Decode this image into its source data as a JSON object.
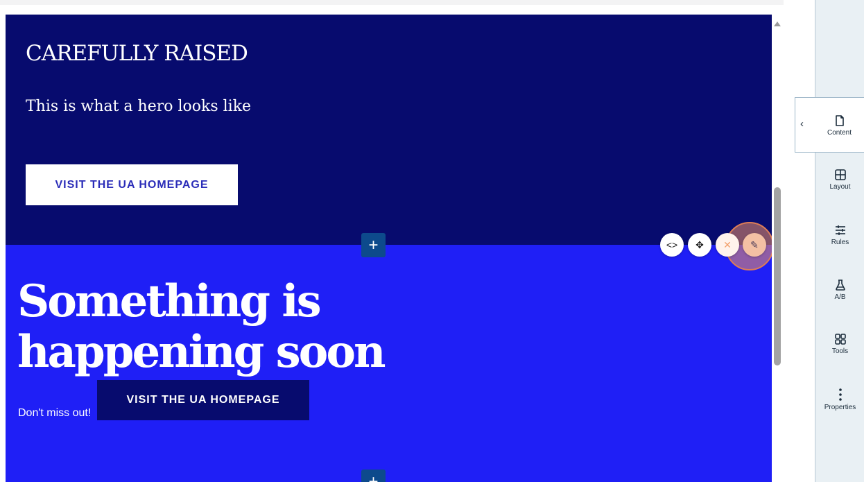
{
  "hero": {
    "title": "CAREFULLY RAISED",
    "subtitle": "This is what a hero looks like",
    "button_label": "VISIT THE UA HOMEPAGE"
  },
  "promo": {
    "title": "Something is happening soon",
    "text": "Don't miss out!",
    "button_label": "VISIT THE UA HOMEPAGE"
  },
  "add_buttons": [
    "+",
    "+"
  ],
  "block_toolbar": [
    {
      "name": "code-icon",
      "glyph": "<>"
    },
    {
      "name": "move-icon",
      "glyph": "✥"
    },
    {
      "name": "close-icon",
      "glyph": "✕"
    },
    {
      "name": "pencil-icon",
      "glyph": "✎"
    }
  ],
  "sidebar": {
    "items": [
      {
        "label": "Content",
        "icon": "document-icon"
      },
      {
        "label": "Layout",
        "icon": "layout-grid-icon"
      },
      {
        "label": "Rules",
        "icon": "sliders-icon"
      },
      {
        "label": "A/B",
        "icon": "flask-icon"
      },
      {
        "label": "Tools",
        "icon": "apps-icon"
      },
      {
        "label": "Properties",
        "icon": "more-vertical-icon"
      }
    ],
    "collapse_glyph": "‹"
  },
  "colors": {
    "hero_bg": "#070b6e",
    "promo_bg": "#1f1ff6",
    "hero_button_text": "#2a2cb8",
    "add_button": "#0d4a8c",
    "sidebar_bg": "#e9f0f4"
  }
}
